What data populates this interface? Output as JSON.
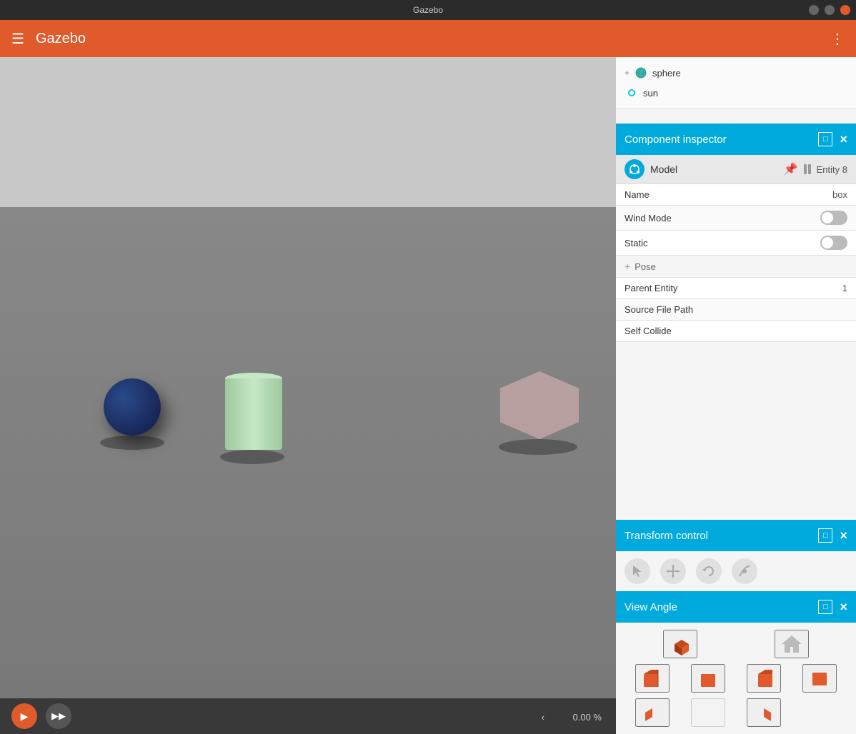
{
  "titleBar": {
    "title": "Gazebo"
  },
  "header": {
    "appName": "Gazebo",
    "hamburgerIcon": "☰",
    "moreIcon": "⋮"
  },
  "entityTree": {
    "items": [
      {
        "name": "sphere",
        "type": "model"
      },
      {
        "name": "sun",
        "type": "light"
      }
    ]
  },
  "componentInspector": {
    "title": "Component inspector",
    "modelIcon": "⬡",
    "modelLabel": "Model",
    "entityLabel": "Entity 8",
    "rows": [
      {
        "label": "Name",
        "value": "box",
        "type": "text"
      },
      {
        "label": "Wind Mode",
        "value": "",
        "type": "toggle",
        "on": false
      },
      {
        "label": "Static",
        "value": "",
        "type": "toggle",
        "on": false
      },
      {
        "label": "Pose",
        "value": "",
        "type": "expandable"
      },
      {
        "label": "Parent Entity",
        "value": "1",
        "type": "text"
      },
      {
        "label": "Source File Path",
        "value": "",
        "type": "text"
      },
      {
        "label": "Self Collide",
        "value": "",
        "type": "text"
      }
    ]
  },
  "transformControl": {
    "title": "Transform control",
    "buttons": [
      {
        "icon": "↖",
        "name": "select"
      },
      {
        "icon": "✛",
        "name": "translate"
      },
      {
        "icon": "↻",
        "name": "rotate"
      },
      {
        "icon": "⌒",
        "name": "scale"
      }
    ]
  },
  "viewAngle": {
    "title": "View Angle"
  },
  "bottomBar": {
    "playLabel": "▶",
    "fastFwdLabel": "▶▶",
    "zoomPercent": "0.00 %"
  }
}
